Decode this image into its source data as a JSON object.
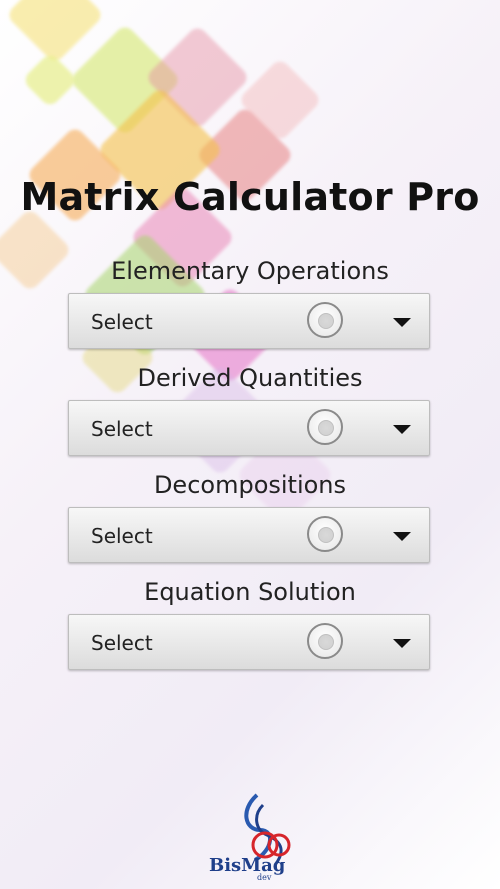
{
  "app": {
    "title": "Matrix Calculator Pro"
  },
  "sections": [
    {
      "label": "Elementary Operations",
      "select_value": "Select"
    },
    {
      "label": "Derived Quantities",
      "select_value": "Select"
    },
    {
      "label": "Decompositions",
      "select_value": "Select"
    },
    {
      "label": "Equation Solution",
      "select_value": "Select"
    }
  ],
  "branding": {
    "logo_text": "BisMag",
    "logo_sub": "dev",
    "colors": {
      "logo_blue": "#1f3f8a",
      "logo_red": "#d6252b"
    }
  },
  "icons": {
    "radio": "radio-circle-icon",
    "dropdown": "caret-down-icon"
  }
}
